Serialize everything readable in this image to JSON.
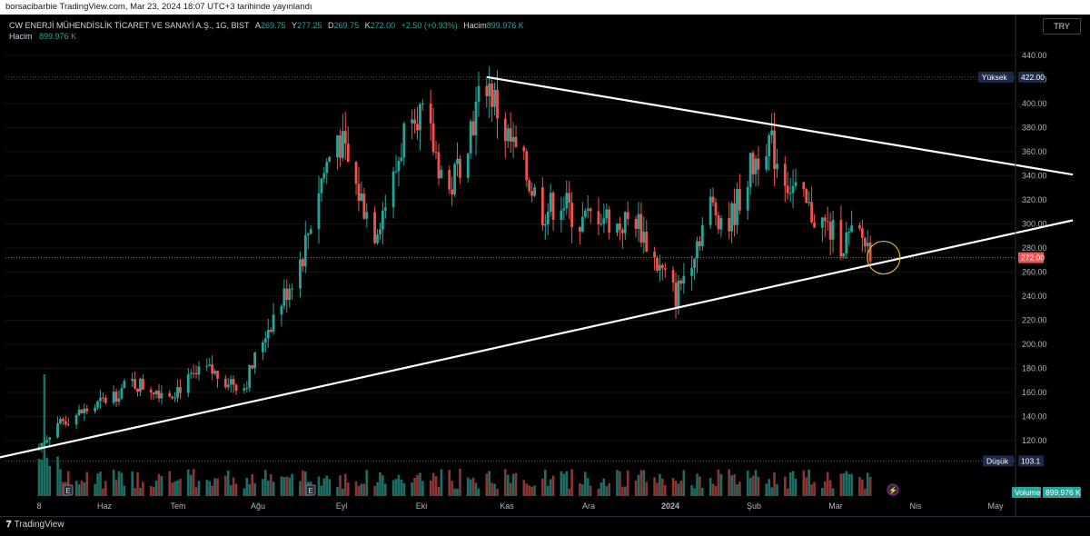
{
  "header": {
    "publisher": "borsacibarbie TradingView.com, Mar 23, 2024 18:07 UTC+3 tarihinde yayınlandı"
  },
  "legend": {
    "symbol": "CW ENERJİ MÜHENDİSLİK TİCARET VE SANAYİ A.Ş., 1G, BIST",
    "open_label": "A",
    "open": "269.75",
    "high_label": "Y",
    "high": "277.25",
    "low_label": "D",
    "low": "269.75",
    "close_label": "K",
    "close": "272.00",
    "change": "+2.50 (+0.93%)",
    "volume_label": "Hacim",
    "volume": "899.976 K",
    "volume2_label": "Hacim",
    "volume2": "899.976 K"
  },
  "currency": "TRY",
  "branding": "TradingView",
  "colors": {
    "up": "#26a69a",
    "down": "#ef5350",
    "background": "#000000",
    "trendline": "#ffffff",
    "highlight_circle": "#d4b83a",
    "axis_text": "#b2b5be"
  },
  "chart_data": {
    "type": "candlestick",
    "x_tick_labels": [
      "8",
      "Haz",
      "Tem",
      "Ağu",
      "Eyl",
      "Eki",
      "Kas",
      "Ara",
      "2024",
      "Şub",
      "Mar",
      "Nis",
      "May"
    ],
    "y_tick_labels": [
      "120.00",
      "140.00",
      "160.00",
      "180.00",
      "200.00",
      "220.00",
      "240.00",
      "260.00",
      "280.00",
      "300.00",
      "320.00",
      "340.00",
      "360.00",
      "380.00",
      "400.00",
      "420.00",
      "440.00"
    ],
    "ylim": [
      98,
      470
    ],
    "price_labels": [
      {
        "name": "Yüksek",
        "value": "422.00"
      },
      {
        "name": "Düşük",
        "value": "103.1"
      },
      {
        "name": "",
        "value": "272.00"
      },
      {
        "name": "Volume",
        "value": "899.976 K"
      }
    ],
    "high": 422.0,
    "low": 103.1,
    "last_close": 272.0,
    "price_path": [
      [
        "2023-05-08",
        115
      ],
      [
        "2023-05-15",
        135
      ],
      [
        "2023-05-29",
        148
      ],
      [
        "2023-06-12",
        168
      ],
      [
        "2023-06-26",
        160
      ],
      [
        "2023-07-10",
        178
      ],
      [
        "2023-07-24",
        165
      ],
      [
        "2023-08-01",
        210
      ],
      [
        "2023-08-08",
        240
      ],
      [
        "2023-08-15",
        275
      ],
      [
        "2023-08-21",
        330
      ],
      [
        "2023-08-28",
        375
      ],
      [
        "2023-09-04",
        330
      ],
      [
        "2023-09-11",
        295
      ],
      [
        "2023-09-18",
        335
      ],
      [
        "2023-09-25",
        405
      ],
      [
        "2023-10-02",
        370
      ],
      [
        "2023-10-09",
        325
      ],
      [
        "2023-10-16",
        375
      ],
      [
        "2023-10-23",
        420
      ],
      [
        "2023-10-30",
        375
      ],
      [
        "2023-11-06",
        345
      ],
      [
        "2023-11-13",
        310
      ],
      [
        "2023-11-20",
        320
      ],
      [
        "2023-11-27",
        300
      ],
      [
        "2023-12-04",
        310
      ],
      [
        "2023-12-11",
        298
      ],
      [
        "2023-12-18",
        305
      ],
      [
        "2023-12-25",
        270
      ],
      [
        "2024-01-02",
        240
      ],
      [
        "2024-01-08",
        275
      ],
      [
        "2024-01-15",
        315
      ],
      [
        "2024-01-22",
        300
      ],
      [
        "2024-01-29",
        340
      ],
      [
        "2024-02-05",
        372
      ],
      [
        "2024-02-12",
        340
      ],
      [
        "2024-02-19",
        315
      ],
      [
        "2024-02-26",
        300
      ],
      [
        "2024-03-04",
        285
      ],
      [
        "2024-03-11",
        290
      ],
      [
        "2024-03-18",
        272
      ]
    ],
    "trendlines": [
      {
        "from": [
          "2023-04-17",
          103
        ],
        "to": [
          "2024-05-30",
          303
        ]
      },
      {
        "from": [
          "2023-10-23",
          422
        ],
        "to": [
          "2024-05-30",
          341
        ]
      }
    ],
    "annotation": {
      "type": "circle",
      "date": "2024-03-20",
      "value": 272
    }
  }
}
